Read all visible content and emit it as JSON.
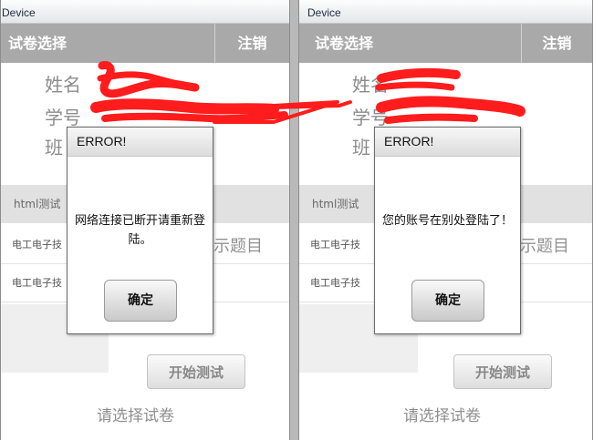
{
  "screens": [
    {
      "window_title": "Device",
      "toolbar": {
        "title": "试卷选择",
        "logout_label": "注销"
      },
      "fields": {
        "name_label": "姓名",
        "student_id_label": "学号",
        "class_label_partial": "班"
      },
      "list": {
        "header": "html测试",
        "row1": "电工电子技",
        "row2": "电工电子技",
        "side_text": "示题目"
      },
      "start_button_label": "开始测试",
      "footer_text": "请选择试卷",
      "dialog": {
        "title": "ERROR!",
        "message": "网络连接已断开请重新登陆。",
        "ok_label": "确定"
      }
    },
    {
      "window_title": "Device",
      "toolbar": {
        "title": "试卷选择",
        "logout_label": "注销"
      },
      "fields": {
        "name_label": "姓名",
        "student_id_label": "学号",
        "class_label_partial": "班"
      },
      "list": {
        "header": "html测试",
        "row1": "电工电子技",
        "row2": "电工电子技",
        "side_text": "示题目"
      },
      "start_button_label": "开始测试",
      "footer_text": "请选择试卷",
      "dialog": {
        "title": "ERROR!",
        "message": "您的账号在别处登陆了！",
        "ok_label": "确定"
      }
    }
  ],
  "redaction_color": "#ff1c1c",
  "toolbar_color": "#a9a9a9"
}
